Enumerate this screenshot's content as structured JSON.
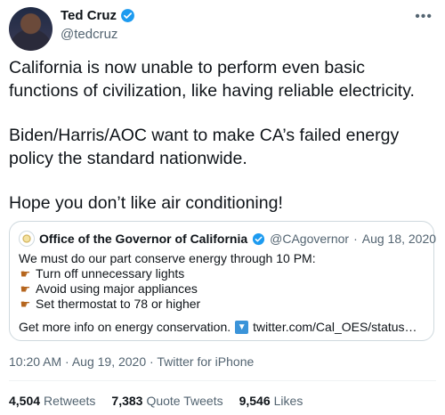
{
  "author": {
    "display_name": "Ted Cruz",
    "handle": "@tedcruz"
  },
  "tweet": {
    "paragraphs": [
      "California is now unable to perform even basic functions of civilization, like having reliable electricity.",
      "Biden/Harris/AOC want to make CA’s failed energy policy the standard nationwide.",
      "Hope you don’t like air conditioning!"
    ],
    "time": "10:20 AM",
    "date": "Aug 19, 2020",
    "source": "Twitter for iPhone"
  },
  "quote": {
    "display_name": "Office of the Governor of California",
    "handle": "@CAgovernor",
    "separator": "·",
    "date": "Aug 18, 2020",
    "intro": "We must do our part conserve energy through 10 PM:",
    "items": [
      "Turn off unnecessary lights",
      "Avoid using major appliances",
      "Set thermostat to 78 or higher"
    ],
    "footer_text": "Get more info on energy conservation.",
    "link_text": "twitter.com/Cal_OES/status…"
  },
  "stats": {
    "retweets_count": "4,504",
    "retweets_label": "Retweets",
    "quotes_count": "7,383",
    "quotes_label": "Quote Tweets",
    "likes_count": "9,546",
    "likes_label": "Likes"
  },
  "colors": {
    "verified": "#1d9bf0",
    "muted": "#536471",
    "border": "#cfd9de"
  },
  "icons": {
    "verified": "verified-badge-icon",
    "more": "more-dots-icon",
    "point": "pointing-hand-icon",
    "arrow": "arrow-down-icon"
  }
}
